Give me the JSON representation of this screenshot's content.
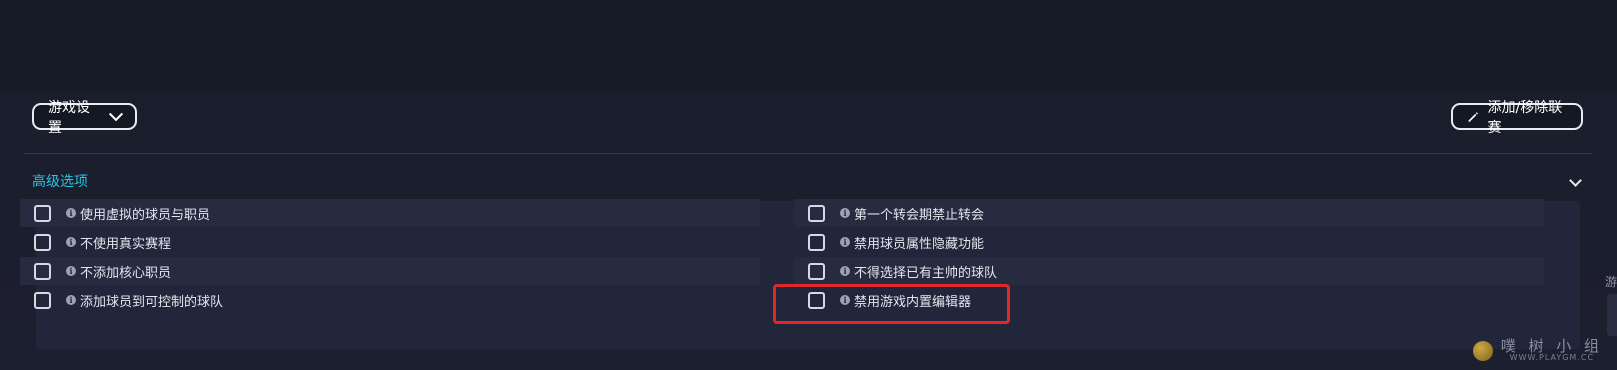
{
  "toolbar": {
    "settings_label": "游戏设置",
    "league_label": "添加/移除联赛"
  },
  "section": {
    "title": "高级选项"
  },
  "options_left": [
    {
      "label": "使用虚拟的球员与职员",
      "checked": false
    },
    {
      "label": "不使用真实赛程",
      "checked": false
    },
    {
      "label": "不添加核心职员",
      "checked": false
    },
    {
      "label": "添加球员到可控制的球队",
      "checked": false
    }
  ],
  "options_right": [
    {
      "label": "第一个转会期禁止转会",
      "checked": false
    },
    {
      "label": "禁用球员属性隐藏功能",
      "checked": false
    },
    {
      "label": "不得选择已有主帅的球队",
      "checked": false
    },
    {
      "label": "禁用游戏内置编辑器",
      "checked": false
    }
  ],
  "side": {
    "glyph": "游"
  },
  "watermark": {
    "cn": "噗 树 小 组",
    "en": "WWW.PLAYGM.CC"
  },
  "colors": {
    "accent": "#2ac3e2",
    "highlight": "#e0282a",
    "background": "#1c1f2e"
  },
  "icons": {
    "settings_dropdown": "chevron-down-icon",
    "league_button": "pencil-icon",
    "section_toggle": "chevron-down-icon",
    "option_info": "info-icon"
  }
}
